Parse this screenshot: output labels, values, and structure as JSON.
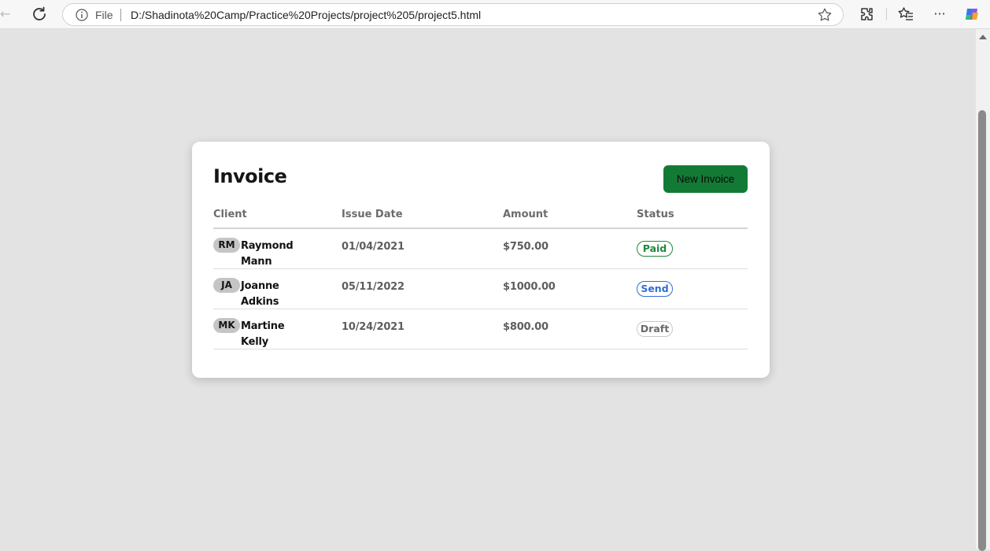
{
  "browser": {
    "file_label": "File",
    "url": "D:/Shadinota%20Camp/Practice%20Projects/project%205/project5.html",
    "more_label": "···"
  },
  "invoice": {
    "title": "Invoice",
    "new_button_label": "New Invoice",
    "columns": [
      "Client",
      "Issue Date",
      "Amount",
      "Status"
    ],
    "rows": [
      {
        "initials": "RM",
        "name": "Raymond Mann",
        "date": "01/04/2021",
        "amount": "$750.00",
        "status": "Paid"
      },
      {
        "initials": "JA",
        "name": "Joanne Adkins",
        "date": "05/11/2022",
        "amount": "$1000.00",
        "status": "Send"
      },
      {
        "initials": "MK",
        "name": "Martine Kelly",
        "date": "10/24/2021",
        "amount": "$800.00",
        "status": "Draft"
      }
    ]
  },
  "colors": {
    "page_background": "#e3e3e3",
    "card_background": "#ffffff",
    "button_green": "#137a36",
    "status_paid": "#1e8a3c",
    "status_send": "#2f6fd6",
    "status_draft": "#6b6b6b"
  },
  "icons": [
    "back-arrow-icon",
    "reload-icon",
    "info-icon",
    "star-icon",
    "extensions-icon",
    "favorites-icon",
    "more-icon",
    "copilot-icon"
  ]
}
